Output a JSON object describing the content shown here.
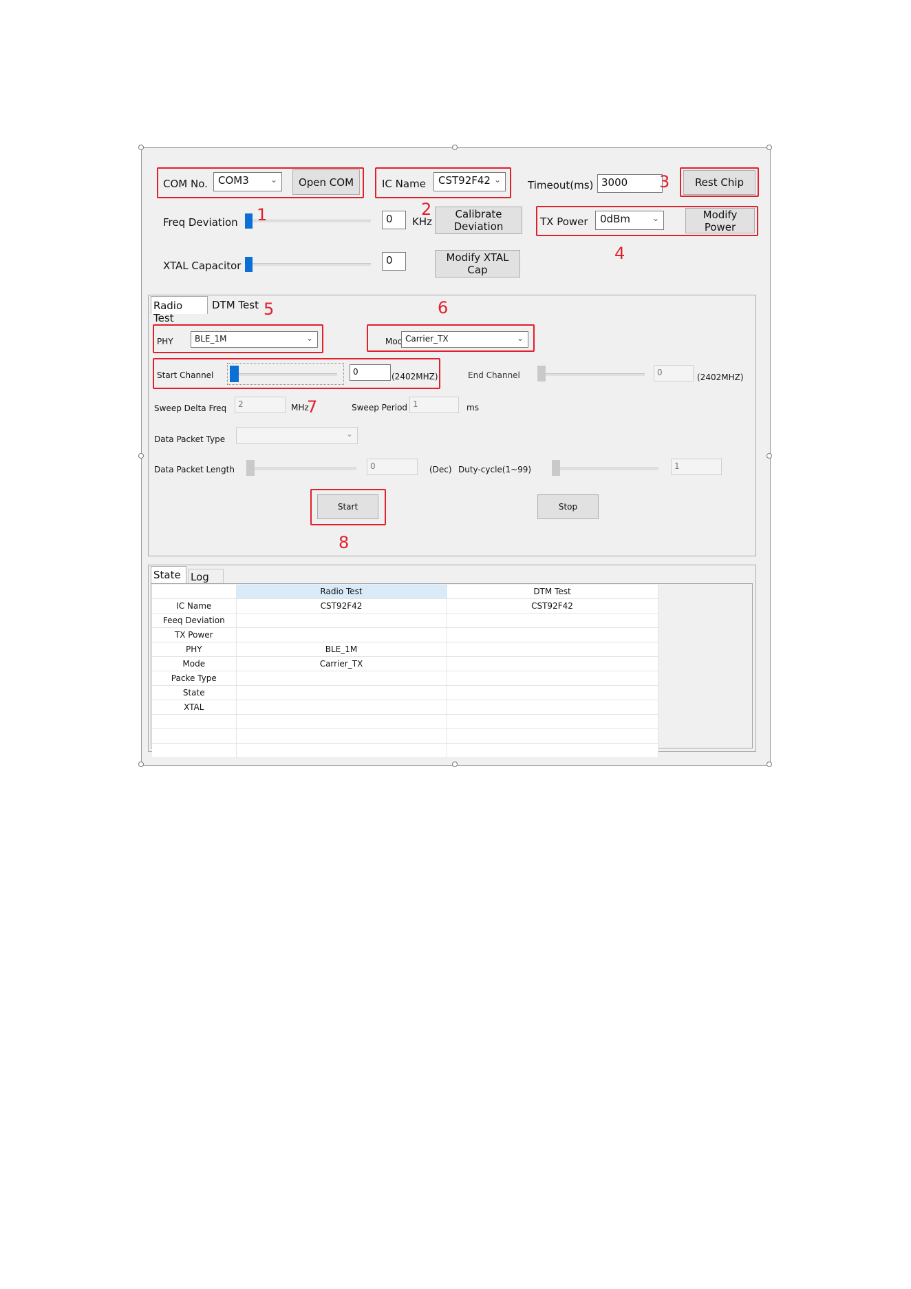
{
  "toolbar": {
    "com_label": "COM No.",
    "com_value": "COM3",
    "open_com": "Open COM",
    "ic_label": "IC Name",
    "ic_value": "CST92F42",
    "timeout_label": "Timeout(ms)",
    "timeout_value": "3000",
    "reset_chip": "Rest Chip"
  },
  "freq": {
    "label": "Freq Deviation",
    "value": "0",
    "unit": "KHz",
    "button": "Calibrate Deviation",
    "slider_level": 0
  },
  "txpower": {
    "label": "TX Power",
    "value": "0dBm",
    "button": "Modify Power"
  },
  "xtal": {
    "label": "XTAL Capacitor",
    "value": "0",
    "button": "Modify XTAL Cap",
    "slider_level": 0
  },
  "callouts": [
    "1",
    "2",
    "3",
    "4",
    "5",
    "6",
    "7",
    "8"
  ],
  "tabs_top": [
    "Radio Test",
    "DTM Test"
  ],
  "radio": {
    "phy_label": "PHY",
    "phy_value": "BLE_1M",
    "mode_label": "Mode",
    "mode_value": "Carrier_TX",
    "start_channel_label": "Start Channel",
    "start_channel_value": "0",
    "start_channel_freq": "(2402MHZ)",
    "end_channel_label": "End Channel",
    "end_channel_value": "0",
    "end_channel_freq": "(2402MHZ)",
    "sweep_delta_label": "Sweep Delta Freq",
    "sweep_delta_value": "2",
    "sweep_delta_unit": "MHz",
    "sweep_period_label": "Sweep Period",
    "sweep_period_value": "1",
    "sweep_period_unit": "ms",
    "packet_type_label": "Data Packet Type",
    "packet_type_value": "",
    "packet_length_label": "Data Packet Length",
    "packet_length_value": "0",
    "packet_length_unit": "(Dec)",
    "duty_cycle_label": "Duty-cycle(1~99)",
    "duty_cycle_value": "1",
    "start_button": "Start",
    "stop_button": "Stop"
  },
  "tabs_bottom": [
    "State",
    "Log"
  ],
  "state_table": {
    "columns": [
      "",
      "Radio Test",
      "DTM Test"
    ],
    "rows": [
      [
        "IC Name",
        "CST92F42",
        "CST92F42"
      ],
      [
        "Feeq Deviation",
        "",
        ""
      ],
      [
        "TX Power",
        "",
        ""
      ],
      [
        "PHY",
        "BLE_1M",
        ""
      ],
      [
        "Mode",
        "Carrier_TX",
        ""
      ],
      [
        "Packe Type",
        "",
        ""
      ],
      [
        "State",
        "",
        ""
      ],
      [
        "XTAL",
        "",
        ""
      ],
      [
        "",
        "",
        ""
      ],
      [
        "",
        "",
        ""
      ],
      [
        "",
        "",
        ""
      ]
    ]
  },
  "colors": {
    "accent": "#0b6fd6",
    "callout": "#e0202a",
    "header_selected": "#d9ebf9"
  }
}
